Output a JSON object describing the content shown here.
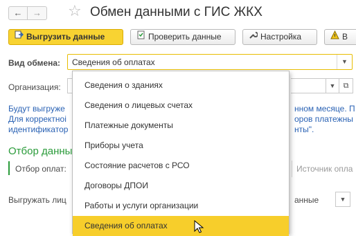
{
  "window": {
    "title": "Обмен данными с ГИС ЖКХ",
    "back_glyph": "←",
    "forward_glyph": "→",
    "favorite_glyph": "☆"
  },
  "toolbar": {
    "upload_label": "Выгрузить данные",
    "check_label": "Проверить данные",
    "settings_label": "Настройка",
    "more_label": "В"
  },
  "form": {
    "exchange_type_label": "Вид обмена:",
    "exchange_type_value": "Сведения об оплатах",
    "organization_label": "Организация:",
    "info_lines": [
      "Будут выгруже",
      "Для корректноі",
      "идентификатор"
    ],
    "info_lines_right": [
      "нном месяце. П",
      "оров платежны",
      "нты\"."
    ],
    "filter_section_title": "Отбор данны",
    "filter_label": "Отбор оплат:",
    "source_column": "Источник опла",
    "upload_label": "Выгружать лиц",
    "data_column": "анные"
  },
  "dropdown": {
    "items": [
      "Сведения о зданиях",
      "Сведения о лицевых счетах",
      "Платежные документы",
      "Приборы учета",
      "Состояние расчетов с РСО",
      "Договоры ДПОИ",
      "Работы и услуги организации",
      "Сведения об оплатах"
    ],
    "selected_index": 7
  },
  "colors": {
    "accent_yellow": "#f7ce2b",
    "link_blue": "#2a62b4",
    "section_green": "#2a9b3a"
  },
  "icons": [
    "arrow-left-icon",
    "arrow-right-icon",
    "star-icon",
    "upload-icon",
    "check-doc-icon",
    "wrench-icon",
    "warning-icon",
    "dropdown-arrow-icon",
    "open-icon",
    "mouse-cursor-icon"
  ]
}
